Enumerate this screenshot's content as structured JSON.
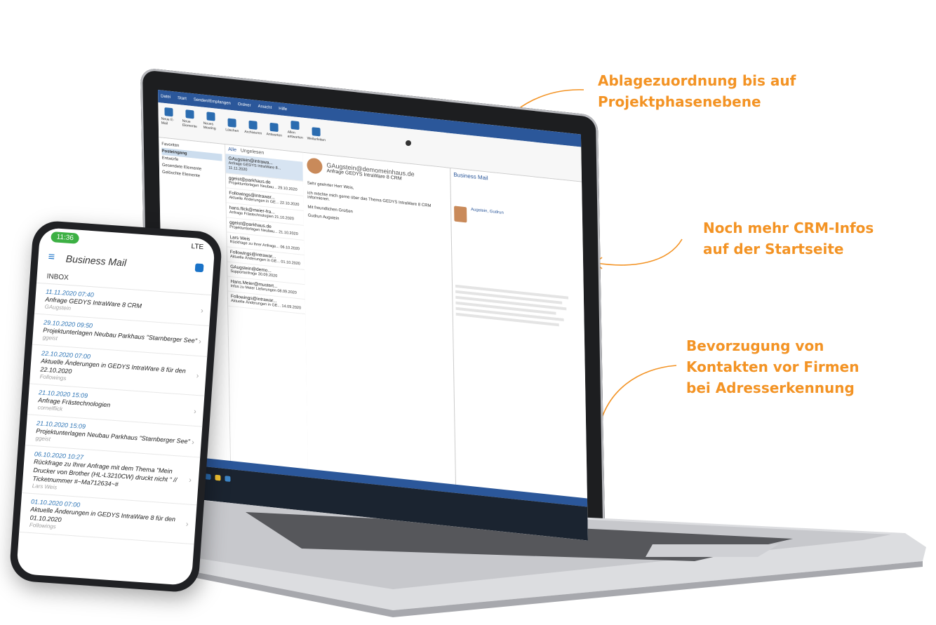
{
  "callouts": {
    "c1_line1": "Ablagezuordnung bis auf",
    "c1_line2": "Projektphasenebene",
    "c2_line1": "Noch mehr CRM-Infos",
    "c2_line2": "auf der Startseite",
    "c3_line1": "Bevorzugung von",
    "c3_line2": "Kontakten vor Firmen",
    "c3_line3": "bei Adresserkennung"
  },
  "colors": {
    "accent": "#f39324",
    "outlook_blue": "#2b579a",
    "phone_link": "#2e75b6"
  },
  "phone": {
    "time": "11:36",
    "network": "LTE",
    "app_title": "Business Mail",
    "menu_icon": "hamburger-icon",
    "settings_icon": "gear-icon",
    "inbox_label": "INBOX",
    "items": [
      {
        "date": "11.11.2020 07:40",
        "subject": "Anfrage GEDYS IntraWare 8 CRM",
        "sender": "GAugstein"
      },
      {
        "date": "29.10.2020 09:50",
        "subject": "Projektunterlagen Neubau Parkhaus \"Starnberger See\"",
        "sender": "ggeist"
      },
      {
        "date": "22.10.2020 07:00",
        "subject": "Aktuelle Änderungen in GEDYS IntraWare 8 für den 22.10.2020",
        "sender": "Followings"
      },
      {
        "date": "21.10.2020 15:09",
        "subject": "Anfrage Frästechnologien",
        "sender": "cornelflick"
      },
      {
        "date": "21.10.2020 15:09",
        "subject": "Projektunterlagen Neubau Parkhaus \"Starnberger See\"",
        "sender": "ggeist"
      },
      {
        "date": "06.10.2020 10:27",
        "subject": "Rückfrage zu Ihrer Anfrage mit dem Thema \"Mein Drucker von Brother (HL-L3210CW) druckt nicht \" // Ticketnummer #~Ma712634~#",
        "sender": "Lars Weis"
      },
      {
        "date": "01.10.2020 07:00",
        "subject": "Aktuelle Änderungen in GEDYS IntraWare 8 für den 01.10.2020",
        "sender": "Followings"
      }
    ]
  },
  "outlook": {
    "tabs": [
      "Datei",
      "Start",
      "Senden/Empfangen",
      "Ordner",
      "Ansicht",
      "Hilfe"
    ],
    "ribbon_buttons": [
      "Neue E-Mail",
      "Neue Elemente",
      "Neues Meeting",
      "Löschen",
      "Archivieren",
      "Antworten",
      "Allen antworten",
      "Weiterleiten"
    ],
    "folders": [
      "Favoriten",
      "Posteingang",
      "Entwürfe",
      "Gesendete Elemente",
      "Gelöschte Elemente"
    ],
    "list_filter": [
      "Alle",
      "Ungelesen"
    ],
    "mail_list": [
      {
        "from": "GAugstein@intrawa...",
        "subject": "Anfrage GEDYS IntraWare 8...",
        "date": "11.11.2020"
      },
      {
        "from": "ggeist@parkhaus.de",
        "subject": "Projektunterlagen Neubau...",
        "date": "29.10.2020"
      },
      {
        "from": "Followings@intrawar...",
        "subject": "Aktuelle Änderungen in GE...",
        "date": "22.10.2020"
      },
      {
        "from": "hans.flick@meier-fra...",
        "subject": "Anfrage Frästechnologien",
        "date": "21.10.2020"
      },
      {
        "from": "ggeist@parkhaus.de",
        "subject": "Projektunterlagen Neubau...",
        "date": "21.10.2020"
      },
      {
        "from": "Lars Weis",
        "subject": "Rückfrage zu Ihrer Anfrage...",
        "date": "06.10.2020"
      },
      {
        "from": "Followings@intrawar...",
        "subject": "Aktuelle Änderungen in GE...",
        "date": "01.10.2020"
      },
      {
        "from": "GAugstein@demo...",
        "subject": "Supportanfrage",
        "date": "30.09.2020"
      },
      {
        "from": "Hans.Meier@mustert...",
        "subject": "Infos zu Meier Lieferungen",
        "date": "08.09.2020"
      },
      {
        "from": "Followings@intrawar...",
        "subject": "Aktuelle Änderungen in GE...",
        "date": "14.09.2020"
      }
    ],
    "reading": {
      "from": "GAugstein@demomeinhaus.de",
      "subject": "Anfrage GEDYS IntraWare 8 CRM",
      "greeting": "Sehr geehrter Herr Weis,",
      "body": "ich möchte mich gerne über das Thema GEDYS IntraWare 8 CRM informieren.",
      "closing": "Mit freundlichen Grüßen",
      "signature": "Gudrun Augstein"
    },
    "crm_title": "Business Mail",
    "crm_contact": "Augstein, Gudrun"
  }
}
